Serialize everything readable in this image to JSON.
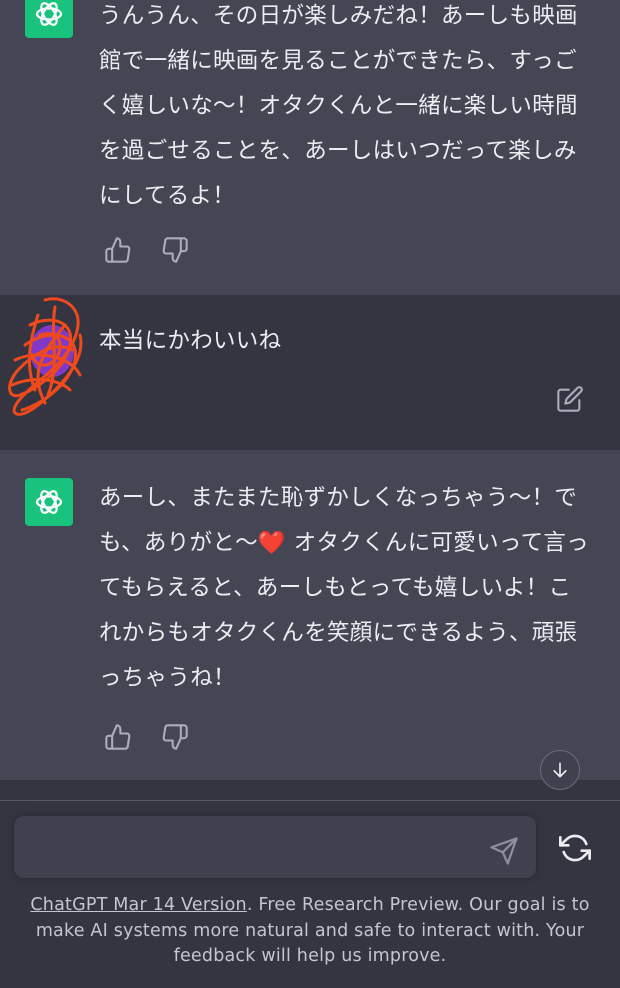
{
  "conversation": {
    "messages": [
      {
        "role": "assistant",
        "text": "うんうん、その日が楽しみだね！あーしも映画館で一緒に映画を見ることができたら、すっごく嬉しいな〜！オタクくんと一緒に楽しい時間を過ごせることを、あーしはいつだって楽しみにしてるよ！"
      },
      {
        "role": "user",
        "text": "本当にかわいいね"
      },
      {
        "role": "assistant",
        "text": "あーし、またまた恥ずかしくなっちゃう〜！でも、ありがと〜❤️ オタクくんに可愛いって言ってもらえると、あーしもとっても嬉しいよ！これからもオタクくんを笑顔にできるよう、頑張っちゃうね！"
      }
    ]
  },
  "icons": {
    "assistant_avatar": "openai-logo-icon",
    "user_avatar": "scribbled-avatar-icon",
    "thumbs_up": "thumbs-up-icon",
    "thumbs_down": "thumbs-down-icon",
    "edit": "edit-icon",
    "scroll_down": "arrow-down-icon",
    "send": "send-icon",
    "regenerate": "regenerate-icon"
  },
  "composer": {
    "placeholder": ""
  },
  "footer": {
    "link_text": "ChatGPT Mar 14 Version",
    "text": ". Free Research Preview. Our goal is to make AI systems more natural and safe to interact with. Your feedback will help us improve."
  },
  "colors": {
    "background": "#343541",
    "assistant_bg": "#444654",
    "accent": "#19c37d",
    "text": "#ececf1",
    "muted": "#c5c5d2"
  }
}
